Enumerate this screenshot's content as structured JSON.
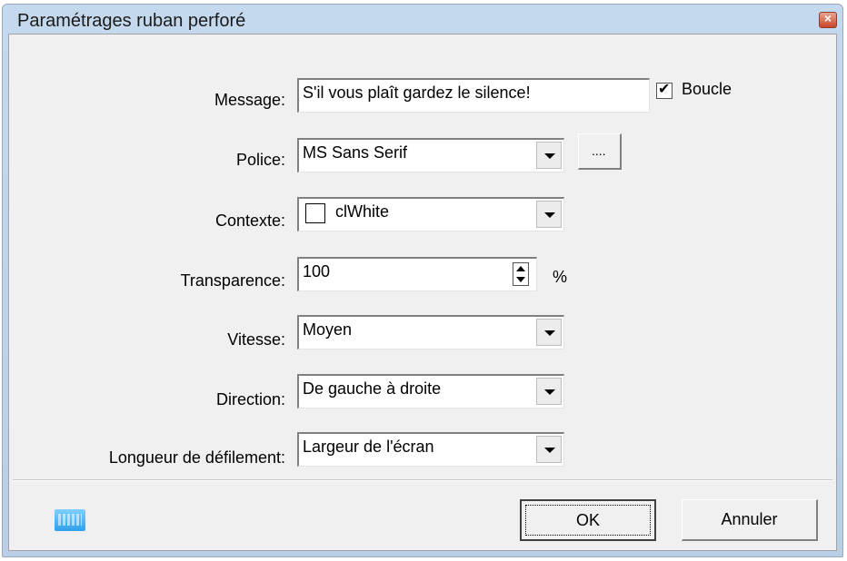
{
  "window": {
    "title": "Paramétrages ruban perforé",
    "close_glyph": "×"
  },
  "form": {
    "message": {
      "label": "Message:",
      "value": "S'il vous plaît gardez le silence!"
    },
    "loop": {
      "label": "Boucle",
      "checked": true
    },
    "font": {
      "label": "Police:",
      "value": "MS Sans Serif",
      "browse_label": "...."
    },
    "background": {
      "label": "Contexte:",
      "value": "clWhite",
      "swatch_color": "#ffffff"
    },
    "transparency": {
      "label": "Transparence:",
      "value": "100",
      "unit": "%"
    },
    "speed": {
      "label": "Vitesse:",
      "value": "Moyen"
    },
    "direction": {
      "label": "Direction:",
      "value": "De gauche à droite"
    },
    "scroll_length": {
      "label": "Longueur de défilement:",
      "value": "Largeur de l'écran"
    }
  },
  "footer": {
    "keyboard_icon": "keyboard-icon",
    "ok_label": "OK",
    "cancel_label": "Annuler"
  }
}
